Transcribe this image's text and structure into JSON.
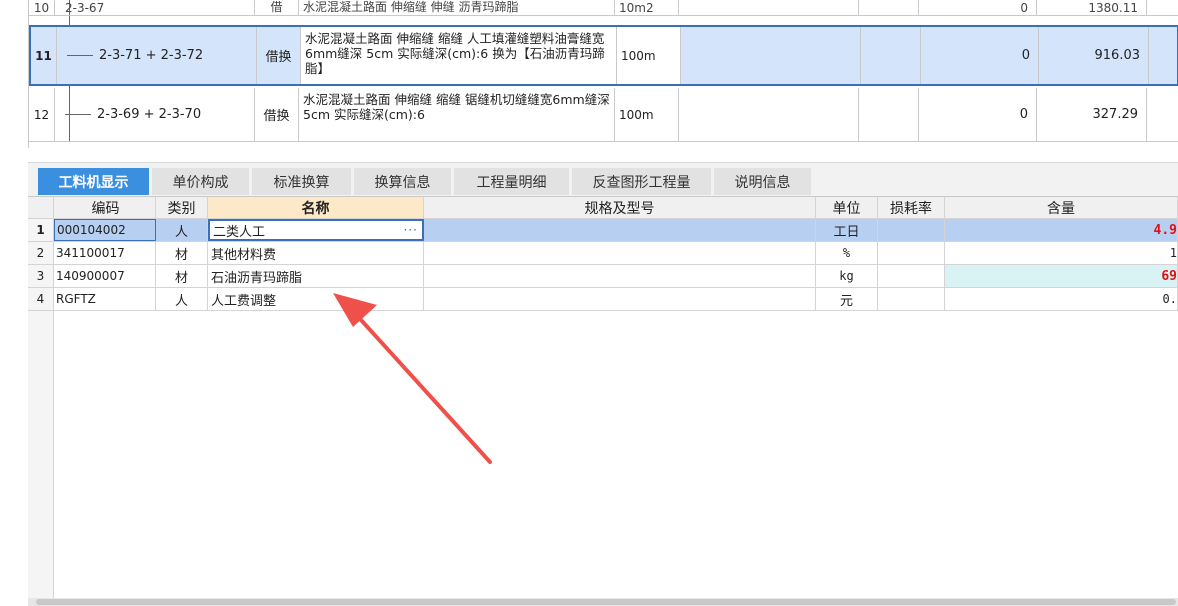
{
  "upper_grid": {
    "partial_row": {
      "num": "10",
      "code": "2-3-67",
      "type": "借",
      "name": "水泥混凝土路面 伸缩缝 伸缝 沥青玛蹄脂",
      "unit": "10m2",
      "qty": "0",
      "price": "1380.11"
    },
    "rows": [
      {
        "num": "11",
        "code": "2-3-71 + 2-3-72",
        "type": "借换",
        "name": "水泥混凝土路面 伸缩缝 缩缝 人工填灌缝塑料油膏缝宽6mm缝深 5cm  实际缝深(cm):6 换为【石油沥青玛蹄脂】",
        "unit": "100m",
        "qty": "0",
        "price": "916.03"
      },
      {
        "num": "12",
        "code": "2-3-69 + 2-3-70",
        "type": "借换",
        "name": "水泥混凝土路面 伸缩缝 缩缝 锯缝机切缝缝宽6mm缝深 5cm  实际缝深(cm):6",
        "unit": "100m",
        "qty": "0",
        "price": "327.29"
      }
    ]
  },
  "tabs": [
    {
      "label": "工料机显示",
      "active": true
    },
    {
      "label": "单价构成",
      "active": false
    },
    {
      "label": "标准换算",
      "active": false
    },
    {
      "label": "换算信息",
      "active": false
    },
    {
      "label": "工程量明细",
      "active": false
    },
    {
      "label": "反查图形工程量",
      "active": false
    },
    {
      "label": "说明信息",
      "active": false
    }
  ],
  "lower_grid": {
    "headers": {
      "code": "编码",
      "type": "类别",
      "name": "名称",
      "spec": "规格及型号",
      "unit": "单位",
      "loss": "损耗率",
      "qty": "含量"
    },
    "rows": [
      {
        "num": "1",
        "code": "000104002",
        "type": "人",
        "name": "二类人工",
        "spec": "",
        "unit": "工日",
        "loss": "",
        "qty": "4.9"
      },
      {
        "num": "2",
        "code": "341100017",
        "type": "材",
        "name": "其他材料费",
        "spec": "",
        "unit": "%",
        "loss": "",
        "qty": "1"
      },
      {
        "num": "3",
        "code": "140900007",
        "type": "材",
        "name": "石油沥青玛蹄脂",
        "spec": "",
        "unit": "kg",
        "loss": "",
        "qty": "69"
      },
      {
        "num": "4",
        "code": "RGFTZ",
        "type": "人",
        "name": "人工费调整",
        "spec": "",
        "unit": "元",
        "loss": "",
        "qty": "0."
      }
    ],
    "ellipsis_icon": "ellipsis-icon"
  },
  "colors": {
    "selected_row": "#d4e4fb",
    "selection_border": "#3b6fb6",
    "active_tab": "#3b8fdf",
    "arrow": "#f0504a",
    "highlight_value": "#e01010"
  }
}
